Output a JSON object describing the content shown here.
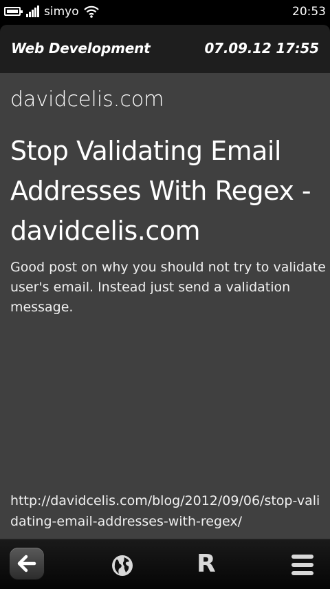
{
  "status_bar": {
    "carrier": "simyo",
    "time": "20:53"
  },
  "header": {
    "category": "Web Development",
    "date": "07.09.12 17:55"
  },
  "article": {
    "site": "davidcelis.com",
    "title": "Stop Validating Email Addresses With Regex - davidcelis.com",
    "description": "Good post on why you should not try to validate user's email. Instead just send a validation message.",
    "url": "http://davidcelis.com/blog/2012/09/06/stop-validating-email-addresses-with-regex/"
  },
  "toolbar": {
    "back_icon": "back-arrow-icon",
    "globe_icon": "globe-icon",
    "r_label": "R",
    "menu_icon": "menu-icon"
  }
}
